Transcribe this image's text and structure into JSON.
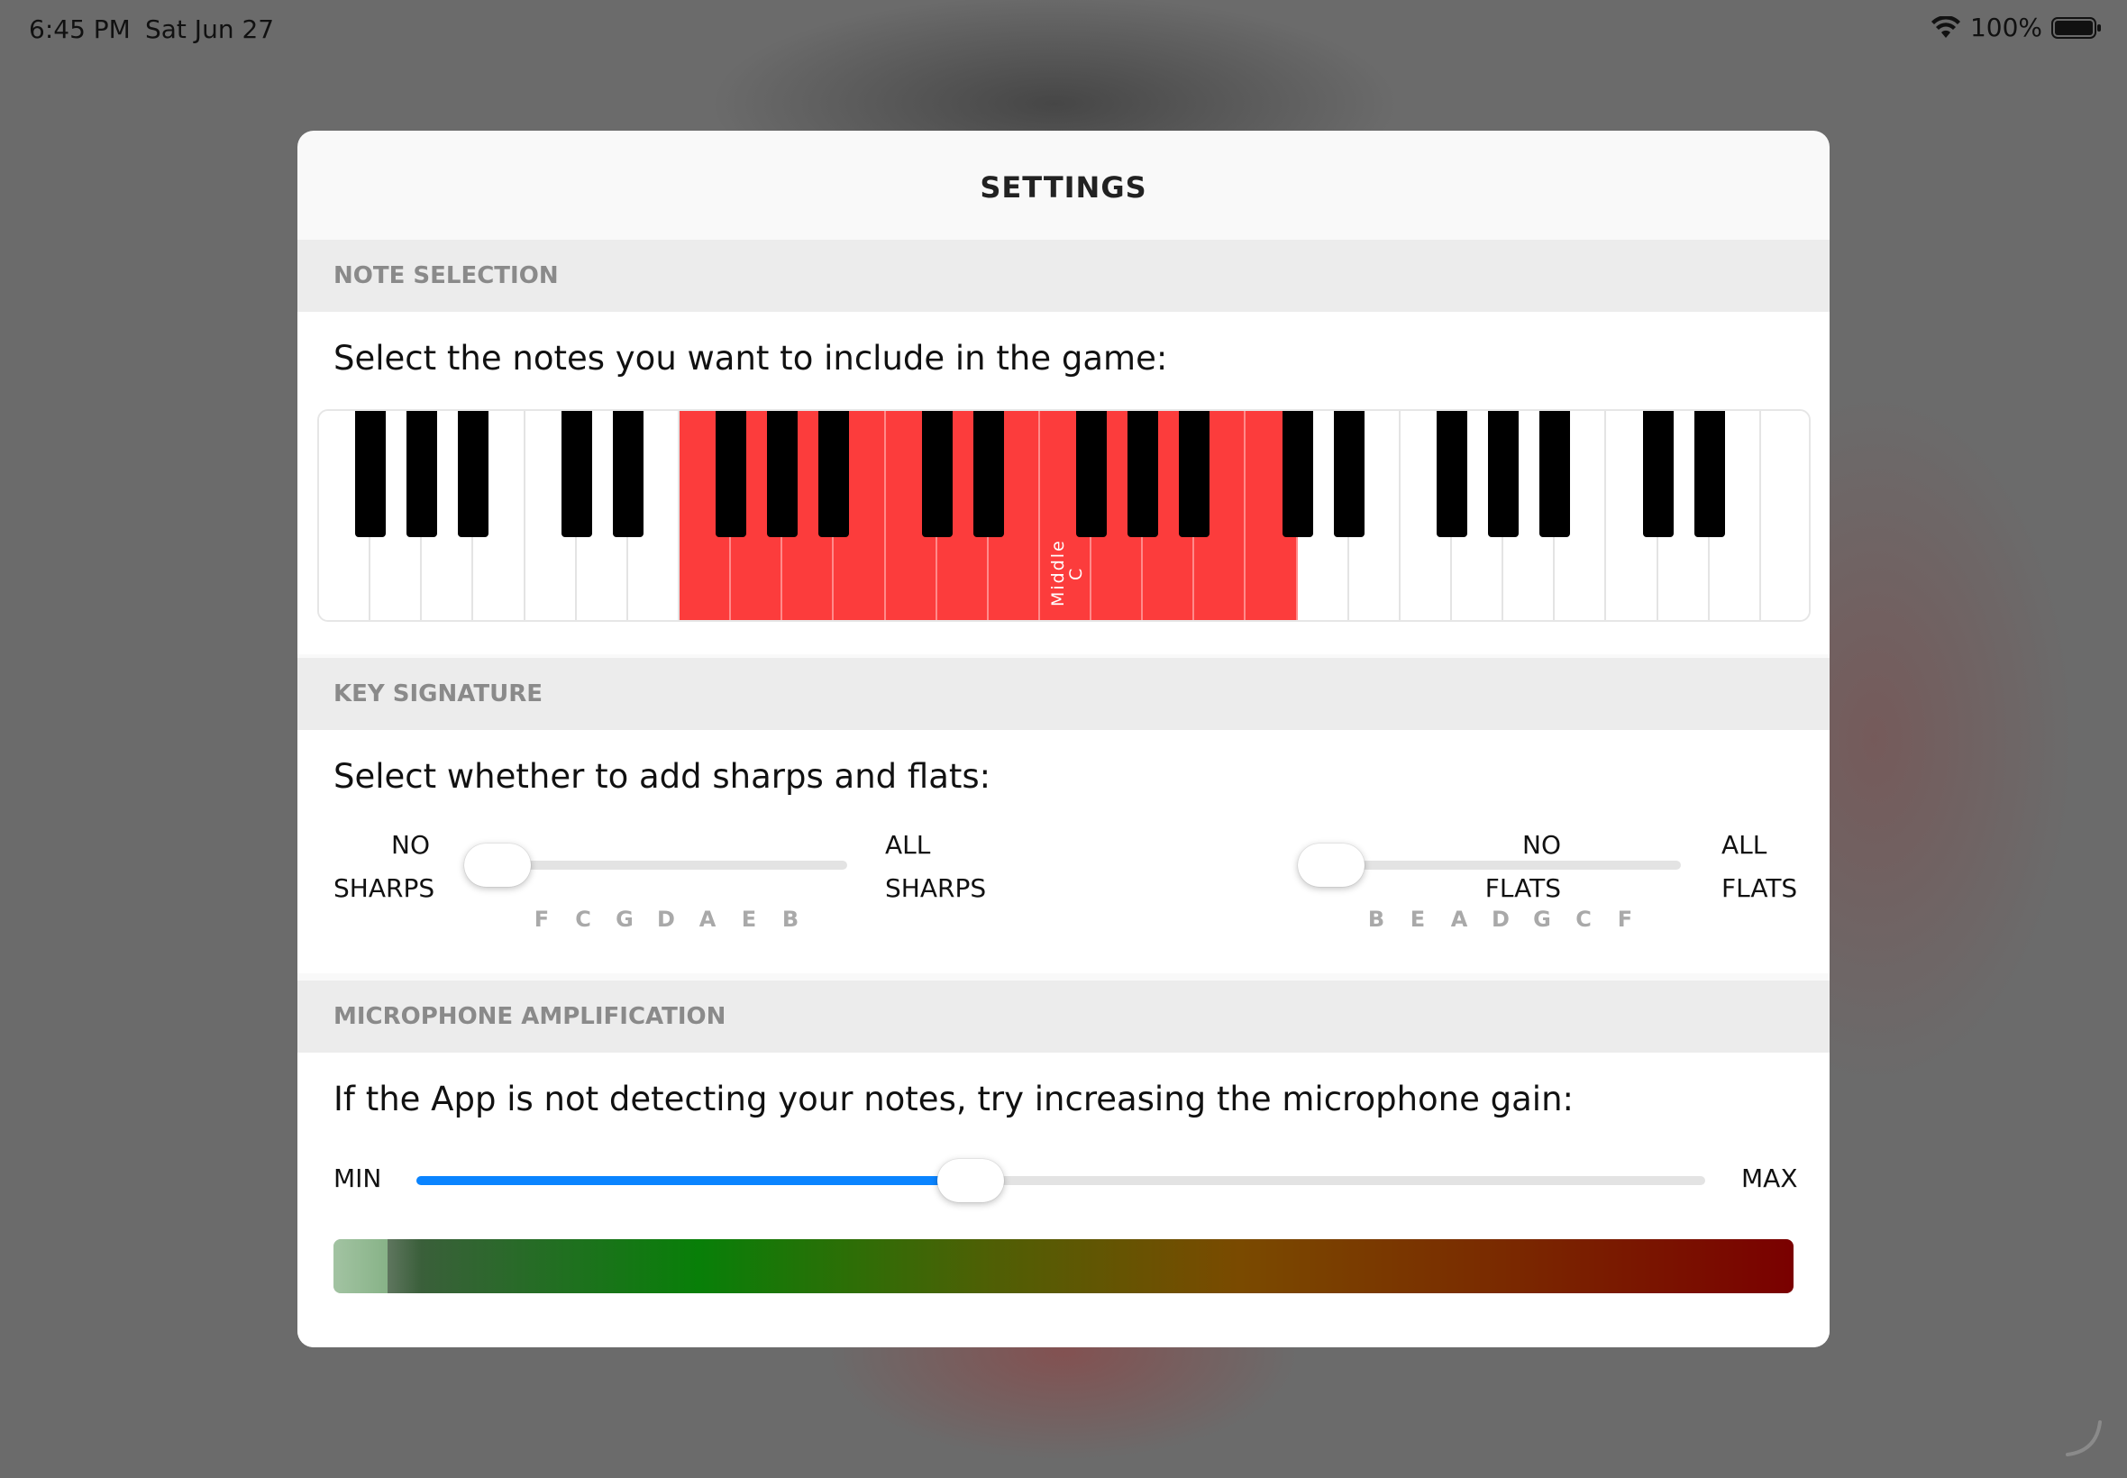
{
  "status_bar": {
    "time": "6:45 PM",
    "date": "Sat Jun 27",
    "battery": "100%"
  },
  "settings": {
    "title": "SETTINGS",
    "note_selection": {
      "header": "NOTE SELECTION",
      "instruction": "Select the notes you want to include in the game:",
      "middle_c_label_line1": "Middle",
      "middle_c_label_line2": "C",
      "selected_range": "white keys 7 through 18 highlighted (12 of 29)"
    },
    "key_signature": {
      "header": "KEY SIGNATURE",
      "instruction": "Select whether to add sharps and flats:",
      "sharps": {
        "min_label_1": "NO",
        "min_label_2": "SHARPS",
        "max_label_1": "ALL",
        "max_label_2": "SHARPS",
        "ticks": [
          "F",
          "C",
          "G",
          "D",
          "A",
          "E",
          "B"
        ],
        "value": 0
      },
      "flats": {
        "min_label_1": "NO",
        "min_label_2": "FLATS",
        "max_label_1": "ALL",
        "max_label_2": "FLATS",
        "ticks": [
          "B",
          "E",
          "A",
          "D",
          "G",
          "C",
          "F"
        ],
        "value": 0
      }
    },
    "microphone": {
      "header": "MICROPHONE AMPLIFICATION",
      "instruction": "If the App is not detecting your notes, try increasing the microphone gain:",
      "min_label": "MIN",
      "max_label": "MAX",
      "gain_fraction": 0.43,
      "level_fraction": 0.037
    }
  },
  "colors": {
    "selected_key": "#fc3c3c",
    "slider_fill": "#0a84ff"
  }
}
